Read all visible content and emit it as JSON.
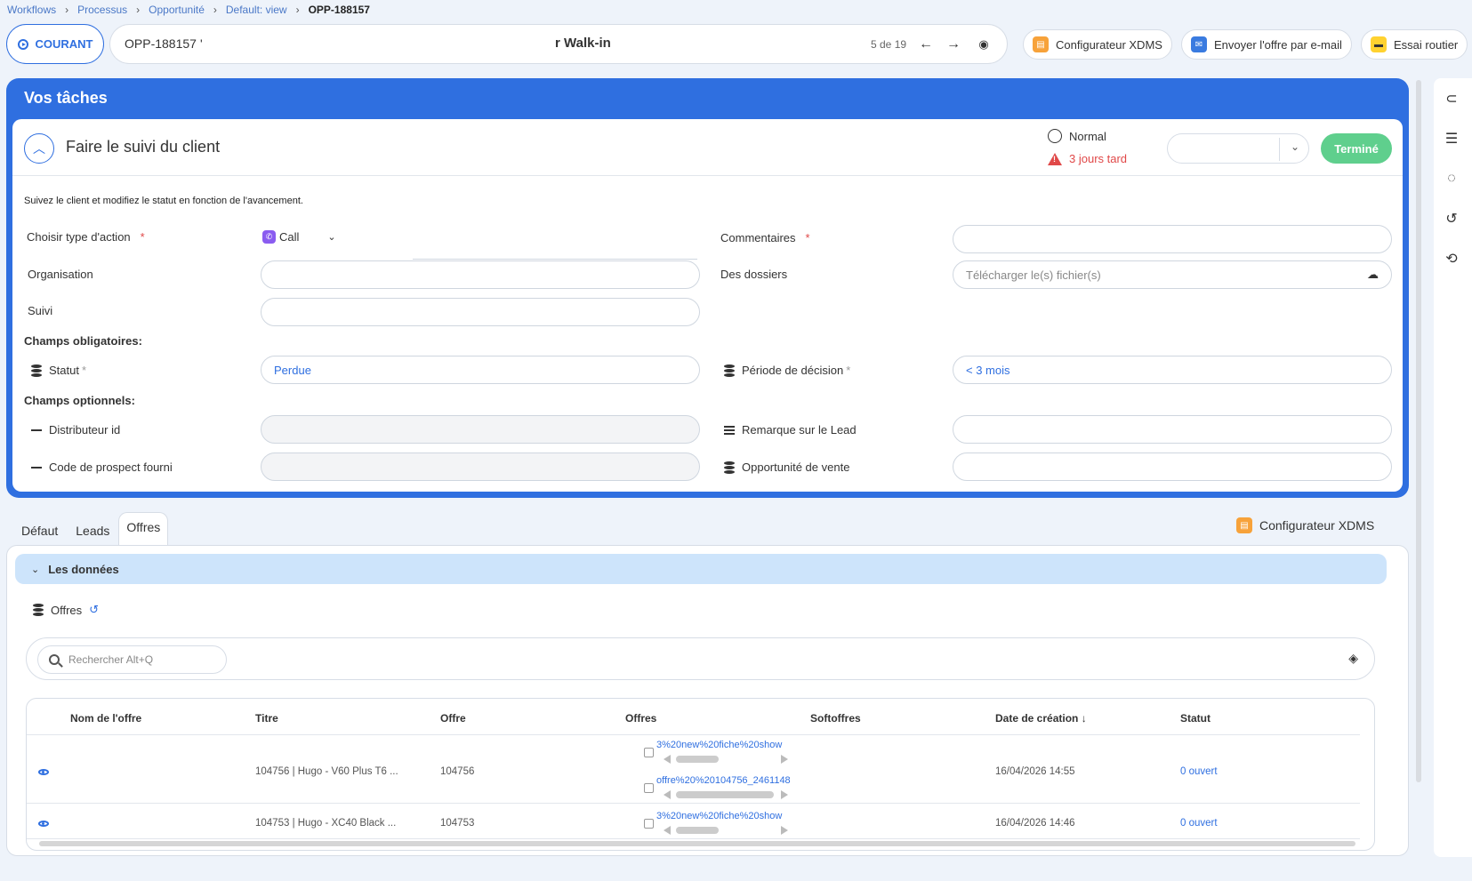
{
  "breadcrumb": {
    "items": [
      "Workflows",
      "Processus",
      "Opportunité",
      "Default: view"
    ],
    "current": "OPP-188157"
  },
  "header": {
    "courant_label": "COURANT",
    "record_id": "OPP-188157",
    "record_tick": "'",
    "record_name": "r Walk-in",
    "pagination": "5 de 19",
    "actions": {
      "xdms": "Configurateur XDMS",
      "email": "Envoyer l'offre par e-mail",
      "essai": "Essai routier"
    }
  },
  "tasks": {
    "panel_title": "Vos tâches",
    "task_title": "Faire le suivi du client",
    "priority": "Normal",
    "late_text": "3 jours tard",
    "done_button": "Terminé",
    "description": "Suivez le client et modifiez le statut en fonction de l'avancement.",
    "fields": {
      "action_type_label": "Choisir type d'action",
      "action_type_value": "Call",
      "comments_label": "Commentaires",
      "organisation_label": "Organisation",
      "dossiers_label": "Des dossiers",
      "dossiers_placeholder": "Télécharger le(s) fichier(s)",
      "suivi_label": "Suivi",
      "mandatory_label": "Champs obligatoires:",
      "statut_label": "Statut",
      "statut_value": "Perdue",
      "periode_label": "Période de décision",
      "periode_value": "< 3 mois",
      "optional_label": "Champs optionnels:",
      "distributeur_label": "Distributeur id",
      "remarque_label": "Remarque sur le Lead",
      "code_label": "Code de prospect fourni",
      "opportunite_label": "Opportunité de vente",
      "required_mark": "*"
    }
  },
  "tabs": {
    "items": [
      "Défaut",
      "Leads",
      "Offres"
    ],
    "active": "Offres",
    "xdms_link": "Configurateur XDMS"
  },
  "data_section": {
    "accordion_label": "Les données",
    "offres_label": "Offres",
    "search_placeholder": "Rechercher Alt+Q",
    "columns": [
      "Nom de l'offre",
      "Titre",
      "Offre",
      "Offres",
      "Softoffres",
      "Date de création",
      "Statut"
    ],
    "rows": [
      {
        "titre": "104756 | Hugo - V60 Plus T6 ...",
        "offre": "104756",
        "files": [
          "3%20new%20fiche%20show",
          "offre%20%20104756_2461148"
        ],
        "date": "16/04/2026 14:55",
        "statut": "0 ouvert"
      },
      {
        "titre": "104753 | Hugo - XC40 Black ...",
        "offre": "104753",
        "files": [
          "3%20new%20fiche%20show"
        ],
        "date": "16/04/2026 14:46",
        "statut": "0 ouvert"
      }
    ]
  },
  "colors": {
    "primary": "#2f6fe0",
    "success": "#5fcf8d",
    "danger": "#e04848",
    "accordion": "#cde4fb"
  }
}
